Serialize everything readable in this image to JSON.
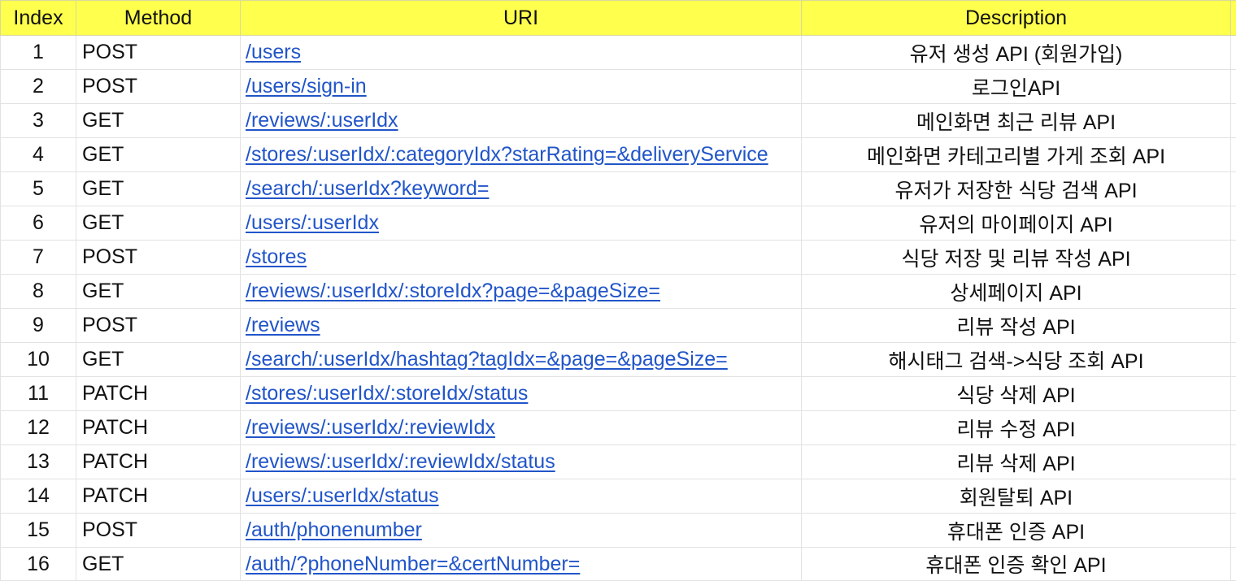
{
  "header": {
    "index": "Index",
    "method": "Method",
    "uri": "URI",
    "description": "Description"
  },
  "colors": {
    "header_bg": "#ffff4d",
    "link": "#2155c9",
    "grid": "#e2e2e2"
  },
  "rows": [
    {
      "index": "1",
      "method": "POST",
      "uri": "/users",
      "description": "유저 생성 API (회원가입)"
    },
    {
      "index": "2",
      "method": "POST",
      "uri": "/users/sign-in",
      "description": "로그인API"
    },
    {
      "index": "3",
      "method": "GET",
      "uri": "/reviews/:userIdx",
      "description": "메인화면 최근 리뷰 API"
    },
    {
      "index": "4",
      "method": "GET",
      "uri": "/stores/:userIdx/:categoryIdx?starRating=&deliveryService",
      "description": "메인화면 카테고리별 가게 조회 API"
    },
    {
      "index": "5",
      "method": "GET",
      "uri": "/search/:userIdx?keyword=",
      "description": "유저가 저장한 식당 검색 API"
    },
    {
      "index": "6",
      "method": "GET",
      "uri": "/users/:userIdx",
      "description": "유저의 마이페이지 API"
    },
    {
      "index": "7",
      "method": "POST",
      "uri": "/stores",
      "description": "식당 저장 및 리뷰 작성 API"
    },
    {
      "index": "8",
      "method": "GET",
      "uri": "/reviews/:userIdx/:storeIdx?page=&pageSize=",
      "description": "상세페이지 API"
    },
    {
      "index": "9",
      "method": "POST",
      "uri": "/reviews",
      "description": "리뷰 작성 API"
    },
    {
      "index": "10",
      "method": "GET",
      "uri": "/search/:userIdx/hashtag?tagIdx=&page=&pageSize=",
      "description": "해시태그 검색->식당 조회 API"
    },
    {
      "index": "11",
      "method": "PATCH",
      "uri": "/stores/:userIdx/:storeIdx/status",
      "description": "식당 삭제 API"
    },
    {
      "index": "12",
      "method": "PATCH",
      "uri": "/reviews/:userIdx/:reviewIdx",
      "description": "리뷰 수정 API"
    },
    {
      "index": "13",
      "method": "PATCH",
      "uri": "/reviews/:userIdx/:reviewIdx/status",
      "description": "리뷰 삭제 API"
    },
    {
      "index": "14",
      "method": "PATCH",
      "uri": "/users/:userIdx/status",
      "description": "회원탈퇴 API"
    },
    {
      "index": "15",
      "method": "POST",
      "uri": "/auth/phonenumber",
      "description": "휴대폰 인증 API"
    },
    {
      "index": "16",
      "method": "GET",
      "uri": "/auth/?phoneNumber=&certNumber=",
      "description": "휴대폰 인증 확인 API"
    }
  ]
}
